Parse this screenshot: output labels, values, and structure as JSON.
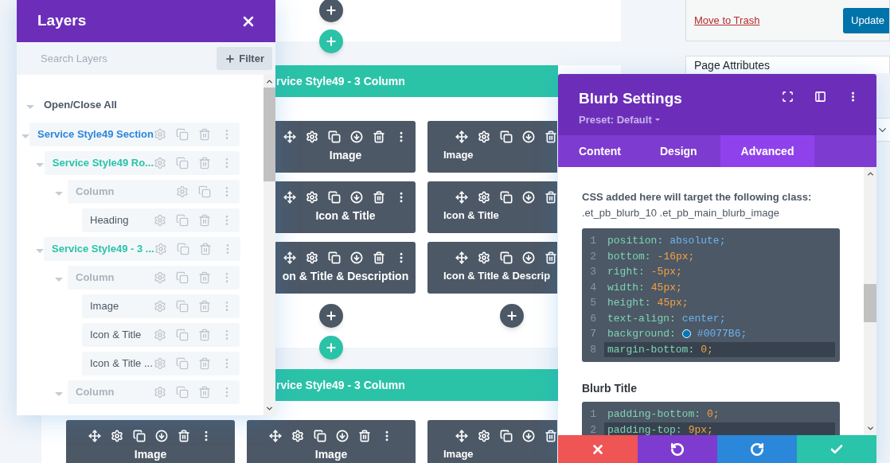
{
  "canvas": {
    "rows": [
      {
        "title": "rvice Style49 - 3 Column",
        "add_module_buttons": true,
        "columns": [
          {
            "kind": "left",
            "modules": [
              "Image",
              "Icon & Title",
              "on & Title & Description"
            ]
          },
          {
            "kind": "right",
            "modules": [
              "Image",
              "Icon & Title",
              "Icon & Title & Descrip"
            ]
          }
        ]
      },
      {
        "title": "rvice Style49 - 3 Column",
        "add_module_buttons": false,
        "columns": [
          {
            "kind": "full",
            "modules": [
              "Image"
            ]
          },
          {
            "kind": "full",
            "modules": [
              "Image"
            ]
          },
          {
            "kind": "right",
            "modules": [
              "Image"
            ]
          }
        ]
      }
    ]
  },
  "wp_sidebar": {
    "trash_link": "Move to Trash",
    "update_button": "Update",
    "page_attributes": {
      "title": "Page Attributes"
    }
  },
  "layers_panel": {
    "title": "Layers",
    "search": {
      "placeholder": "Search Layers"
    },
    "filter_button": "Filter",
    "open_close_all": "Open/Close All",
    "tree": [
      {
        "label": "Service Style49 Section",
        "kind": "section",
        "expanded": true,
        "deletable": true,
        "children": [
          {
            "label": "Service Style49 Ro...",
            "kind": "row",
            "expanded": true,
            "deletable": true,
            "children": [
              {
                "label": "Column",
                "kind": "column",
                "expanded": true,
                "deletable": false,
                "children": [
                  {
                    "label": "Heading",
                    "kind": "module",
                    "deletable": true
                  }
                ]
              }
            ]
          },
          {
            "label": "Service Style49 - 3 ...",
            "kind": "row",
            "expanded": true,
            "deletable": true,
            "children": [
              {
                "label": "Column",
                "kind": "column",
                "expanded": true,
                "deletable": true,
                "children": [
                  {
                    "label": "Image",
                    "kind": "module",
                    "deletable": true
                  },
                  {
                    "label": "Icon & Title",
                    "kind": "module",
                    "deletable": true
                  },
                  {
                    "label": "Icon & Title ...",
                    "kind": "module",
                    "deletable": true
                  }
                ]
              },
              {
                "label": "Column",
                "kind": "column",
                "expanded": true,
                "deletable": true
              }
            ]
          }
        ]
      }
    ]
  },
  "settings_panel": {
    "title": "Blurb Settings",
    "preset": "Preset: Default",
    "tabs": [
      {
        "label": "Content",
        "selected": false
      },
      {
        "label": "Design",
        "selected": false
      },
      {
        "label": "Advanced",
        "selected": true
      }
    ],
    "description": "CSS added here will target the following class:",
    "target_class": ".et_pb_blurb_10 .et_pb_main_blurb_image",
    "code_blocks": [
      {
        "lines": [
          {
            "number": "1",
            "property": "position:",
            "value": "absolute;",
            "kind": "keyword",
            "highlighted": false
          },
          {
            "number": "2",
            "property": "bottom:",
            "value": "-16px;",
            "kind": "number",
            "highlighted": false
          },
          {
            "number": "3",
            "property": "right:",
            "value": "-5px;",
            "kind": "number",
            "highlighted": false
          },
          {
            "number": "4",
            "property": "width:",
            "value": "45px;",
            "kind": "number",
            "highlighted": false
          },
          {
            "number": "5",
            "property": "height:",
            "value": "45px;",
            "kind": "number",
            "highlighted": false
          },
          {
            "number": "6",
            "property": "text-align:",
            "value": "center;",
            "kind": "keyword",
            "highlighted": false
          },
          {
            "number": "7",
            "property": "background:",
            "value": "#0077B6;",
            "kind": "keyword",
            "color": "#0077b6",
            "highlighted": false
          },
          {
            "number": "8",
            "property": "margin-bottom:",
            "value": "0;",
            "kind": "number",
            "highlighted": true
          }
        ]
      },
      {
        "label": "Blurb Title",
        "lines": [
          {
            "number": "1",
            "property": "padding-bottom:",
            "value": "0;",
            "kind": "number",
            "highlighted": false
          },
          {
            "number": "2",
            "property": "padding-top:",
            "value": "9px;",
            "kind": "number",
            "highlighted": true
          }
        ]
      }
    ],
    "footer_actions": [
      {
        "kind": "discard"
      },
      {
        "kind": "undo"
      },
      {
        "kind": "redo"
      },
      {
        "kind": "save"
      }
    ]
  }
}
